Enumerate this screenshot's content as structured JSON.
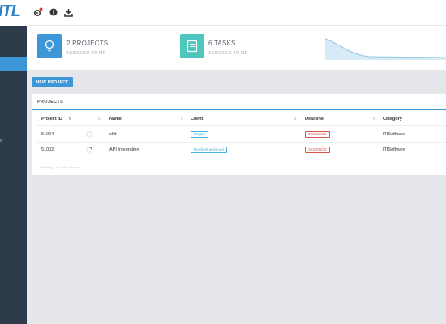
{
  "brand": {
    "logo_text": "ITL"
  },
  "sidebar": {
    "item_fragment": "s"
  },
  "topbar": {
    "icons": [
      "settings-badge-icon",
      "info-icon",
      "download-icon"
    ]
  },
  "stats": {
    "projects": {
      "title": "2 PROJECTS",
      "subtitle": "ASSIGNED TO ME",
      "color": "#3d96d6",
      "icon": "lightbulb-icon"
    },
    "tasks": {
      "title": "6 TASKS",
      "subtitle": "ASSIGNED TO ME",
      "color": "#4fc6bb",
      "icon": "checklist-icon"
    },
    "sparkline_color": "#b9dcef"
  },
  "toolbar": {
    "new_project_label": "NEW PROJECT"
  },
  "projects": {
    "title": "PROJECTS",
    "columns": {
      "project_id": "Project ID",
      "name": "Name",
      "client": "Client",
      "deadline": "Deadline",
      "category": "Category"
    },
    "rows": [
      {
        "project_id": "51004",
        "progress": 0,
        "name": "shit",
        "client": "Mogan",
        "deadline": "2018/01/02",
        "category": "ITISoftware"
      },
      {
        "project_id": "51002",
        "progress": 0.25,
        "name": "API Integration",
        "client": "No client assigned",
        "deadline": "2018/06/30",
        "category": "ITISoftware"
      }
    ],
    "footer": "Showing 1 to 2 of 2 records"
  },
  "colors": {
    "accent": "#3d96d6",
    "sidebar": "#2c3a4a",
    "danger": "#d9534f",
    "client_badge": "#49aee0"
  }
}
